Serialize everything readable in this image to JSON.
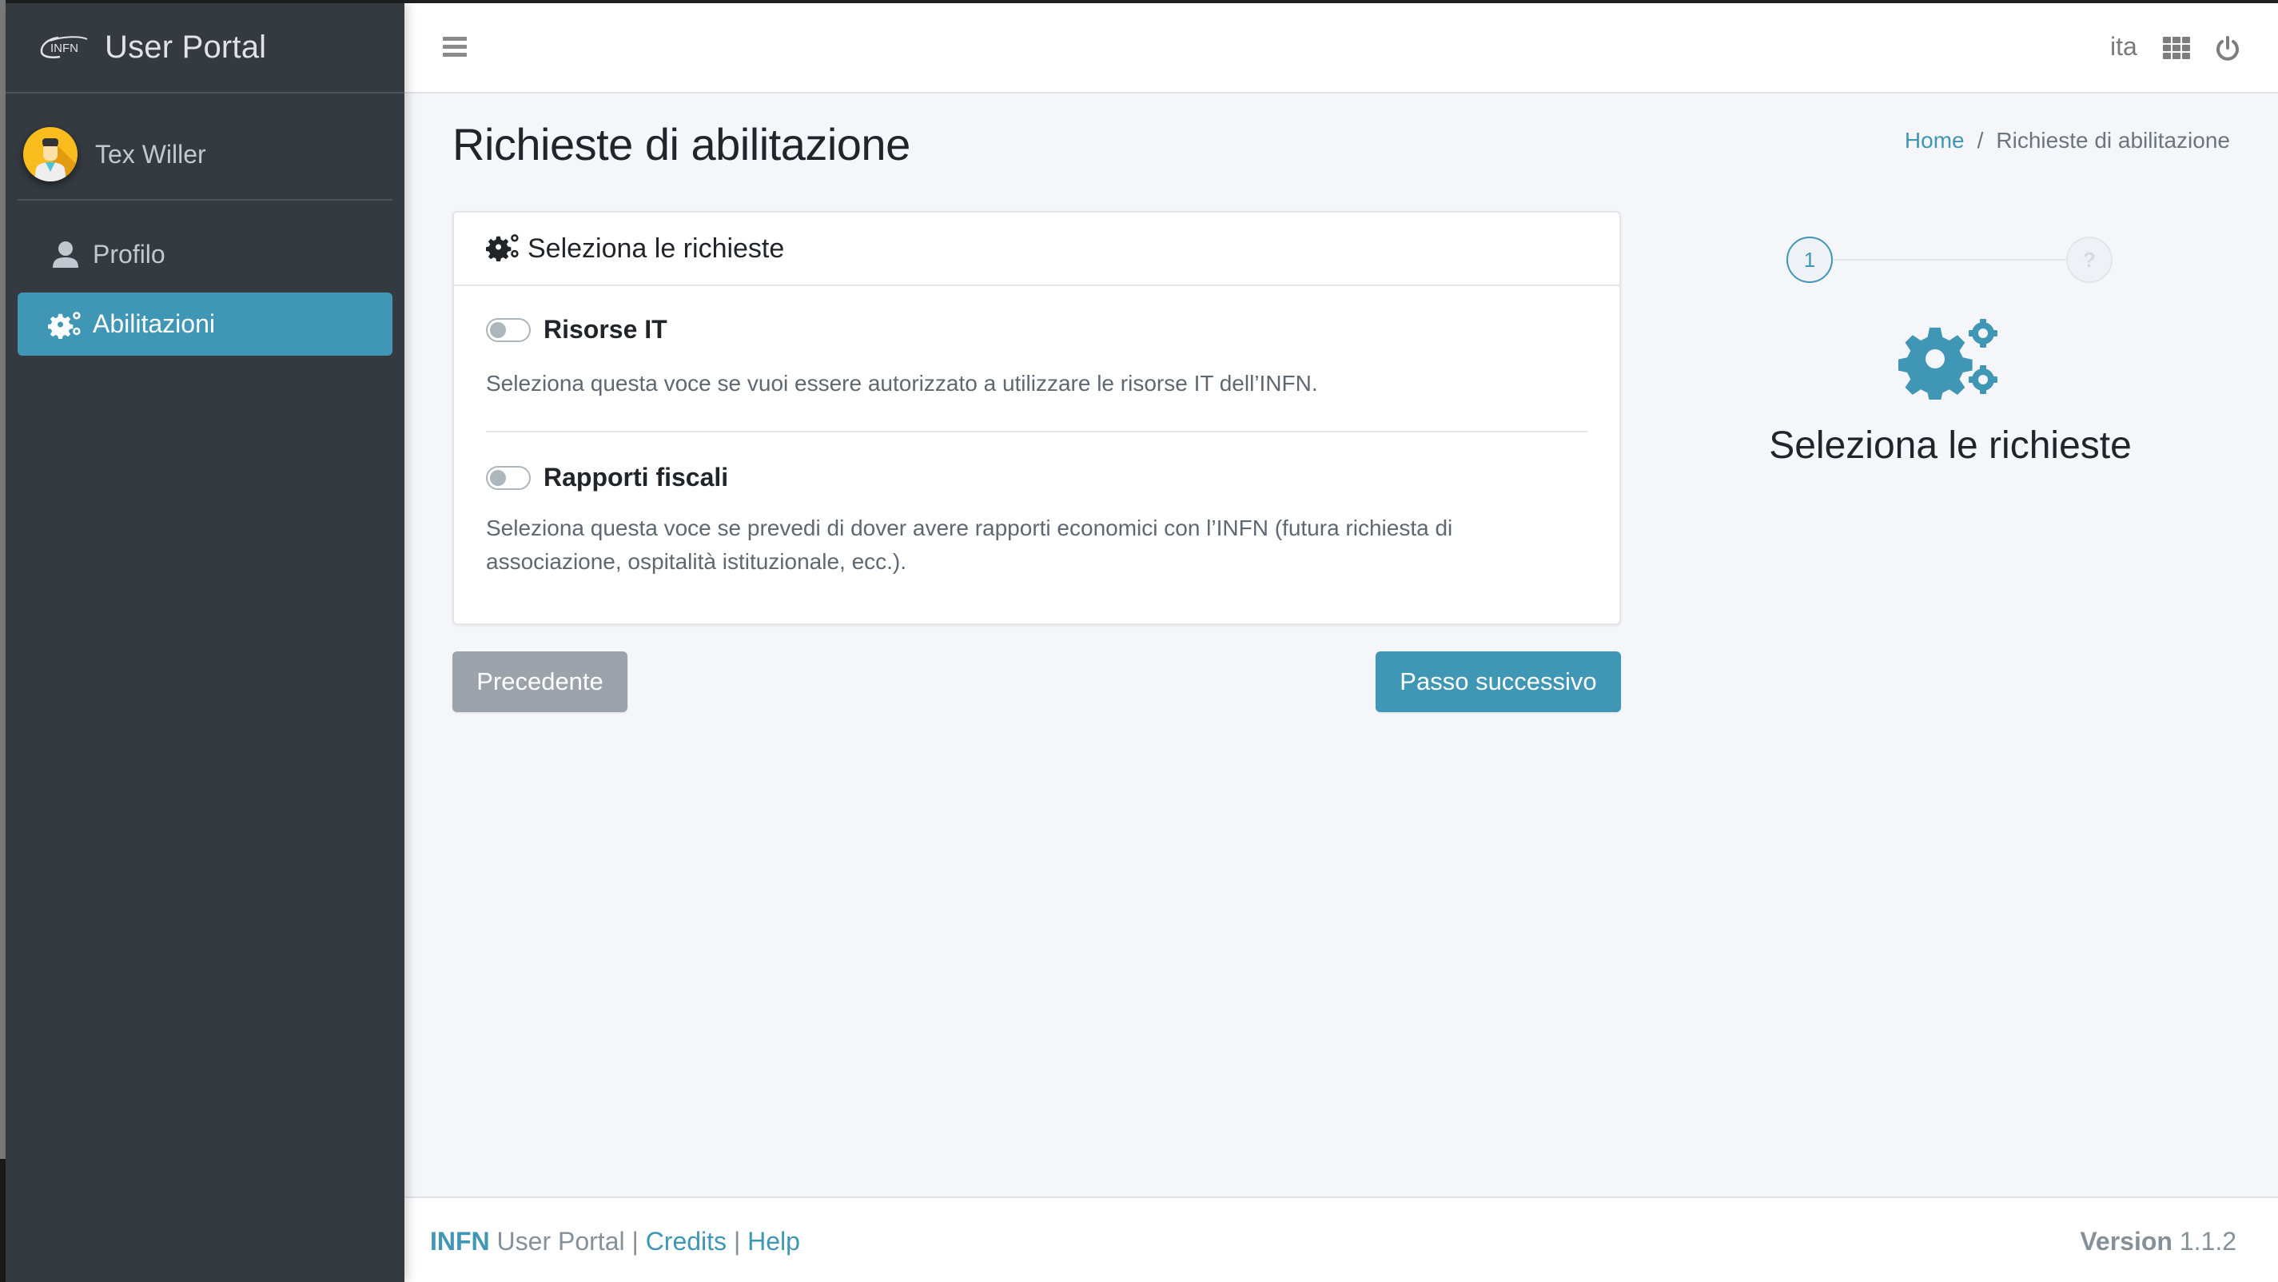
{
  "sidebar": {
    "brand": {
      "logo_text": "INFN",
      "title": "User Portal"
    },
    "user": {
      "name": "Tex Willer"
    },
    "items": [
      {
        "label": "Profilo",
        "icon": "user-icon",
        "active": false
      },
      {
        "label": "Abilitazioni",
        "icon": "cogs-icon",
        "active": true
      }
    ]
  },
  "header": {
    "language": "ita",
    "icons": [
      "menu-icon",
      "apps-grid-icon",
      "power-icon"
    ]
  },
  "page": {
    "title": "Richieste di abilitazione",
    "breadcrumb": [
      {
        "label": "Home",
        "link": true
      },
      {
        "label": "/",
        "link": false
      },
      {
        "label": "Richieste di abilitazione",
        "link": false
      }
    ]
  },
  "card": {
    "header": "Seleziona le richieste",
    "requests": [
      {
        "title": "Risorse IT",
        "enabled": false,
        "description": "Seleziona questa voce se vuoi essere autorizzato a utilizzare le risorse IT dell’INFN."
      },
      {
        "title": "Rapporti fiscali",
        "enabled": false,
        "description": "Seleziona questa voce se prevedi di dover avere rapporti economici con l’INFN (futura richiesta di associazione, ospitalità istituzionale, ecc.)."
      }
    ]
  },
  "buttons": {
    "previous": "Precedente",
    "next": "Passo successivo"
  },
  "stepper": {
    "steps": [
      "1",
      "?"
    ],
    "current_step": 1,
    "title": "Seleziona le richieste"
  },
  "footer": {
    "brand": "INFN",
    "app": "User Portal",
    "sep1": "|",
    "credits": "Credits",
    "sep2": "|",
    "help": "Help",
    "version_label": "Version",
    "version": "1.1.2"
  },
  "colors": {
    "accent": "#4096b5",
    "sidebar_bg": "#343a40",
    "secondary": "#9ca3aa"
  }
}
